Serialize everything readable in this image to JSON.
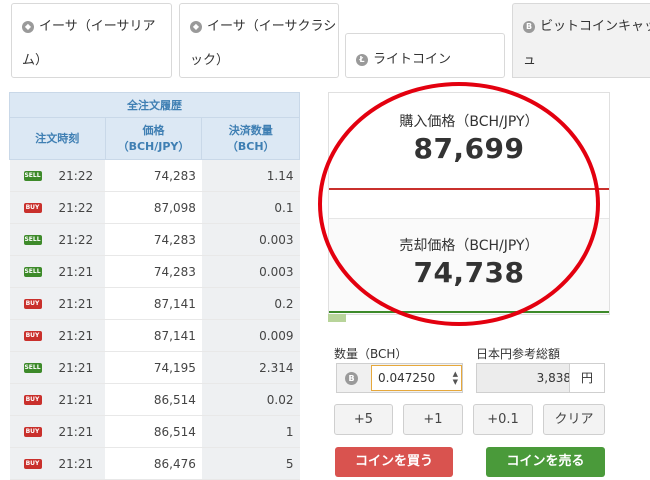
{
  "tabs": [
    {
      "line1": "イーサ（イーサリア",
      "line2": "ム）",
      "icon": "ethereum-icon"
    },
    {
      "line1": "イーサ（イーサクラシ",
      "line2": "ック）",
      "icon": "ethereum-classic-icon"
    },
    {
      "line1": "",
      "line2": "ライトコイン",
      "icon": "litecoin-icon"
    },
    {
      "line1": "ビットコインキャッシ",
      "line2": "ュ",
      "icon": "bitcoin-cash-icon"
    }
  ],
  "history": {
    "caption": "全注文履歴",
    "col_time": "注文時刻",
    "col_price_1": "価格",
    "col_price_2": "（BCH/JPY）",
    "col_qty_1": "決済数量",
    "col_qty_2": "（BCH）",
    "rows": [
      {
        "side": "SELL",
        "time": "21:22",
        "price": "74,283",
        "qty": "1.14"
      },
      {
        "side": "BUY",
        "time": "21:22",
        "price": "87,098",
        "qty": "0.1"
      },
      {
        "side": "SELL",
        "time": "21:22",
        "price": "74,283",
        "qty": "0.003"
      },
      {
        "side": "SELL",
        "time": "21:21",
        "price": "74,283",
        "qty": "0.003"
      },
      {
        "side": "BUY",
        "time": "21:21",
        "price": "87,141",
        "qty": "0.2"
      },
      {
        "side": "BUY",
        "time": "21:21",
        "price": "87,141",
        "qty": "0.009"
      },
      {
        "side": "SELL",
        "time": "21:21",
        "price": "74,195",
        "qty": "2.314"
      },
      {
        "side": "BUY",
        "time": "21:21",
        "price": "86,514",
        "qty": "0.02"
      },
      {
        "side": "BUY",
        "time": "21:21",
        "price": "86,514",
        "qty": "1"
      },
      {
        "side": "BUY",
        "time": "21:21",
        "price": "86,476",
        "qty": "5"
      }
    ]
  },
  "prices": {
    "buy_label": "購入価格（BCH/JPY）",
    "buy_value": "87,699",
    "sell_label": "売却価格（BCH/JPY）",
    "sell_value": "74,738"
  },
  "order": {
    "amount_label": "数量（BCH）",
    "amount_value": "0.047250",
    "ref_label": "日本円参考総額",
    "ref_value": "3,838",
    "ref_unit": "円",
    "quick": [
      "+5",
      "+1",
      "+0.1",
      "クリア"
    ],
    "buy_button": "コインを買う",
    "sell_button": "コインを売る"
  },
  "colors": {
    "buy": "#d9534f",
    "sell": "#4a9a3a",
    "highlight_circle": "#e3000f"
  }
}
